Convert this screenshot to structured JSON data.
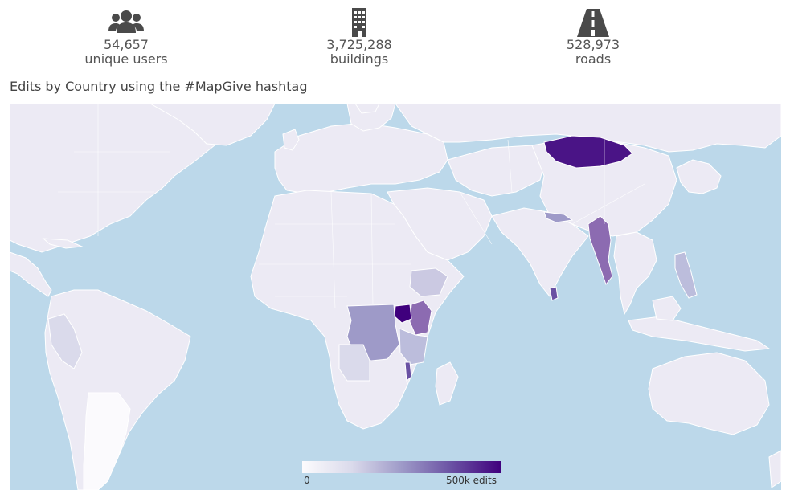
{
  "stats": {
    "users": {
      "value": "54,657",
      "label": "unique users",
      "icon": "users-icon"
    },
    "buildings": {
      "value": "3,725,288",
      "label": "buildings",
      "icon": "building-icon"
    },
    "roads": {
      "value": "528,973",
      "label": "roads",
      "icon": "road-icon"
    }
  },
  "map": {
    "title": "Edits by Country using the #MapGive hashtag",
    "ocean_color": "#bcd8ea",
    "land_color": "#eceaf4",
    "border_color": "#ffffff",
    "legend": {
      "min_label": "0",
      "max_label": "500k edits",
      "colors": [
        "#fcfbfd",
        "#dadaeb",
        "#9e9ac8",
        "#6a51a3",
        "#3f007d"
      ]
    },
    "highlighted_countries": [
      {
        "name": "Uganda",
        "level": 1.0
      },
      {
        "name": "Mongolia",
        "level": 0.95
      },
      {
        "name": "Myanmar",
        "level": 0.7
      },
      {
        "name": "Sri Lanka",
        "level": 0.7
      },
      {
        "name": "Malawi",
        "level": 0.65
      },
      {
        "name": "Kenya",
        "level": 0.6
      },
      {
        "name": "Democratic Republic of the Congo",
        "level": 0.5
      },
      {
        "name": "Tanzania",
        "level": 0.4
      },
      {
        "name": "Philippines",
        "level": 0.45
      },
      {
        "name": "Nepal",
        "level": 0.45
      },
      {
        "name": "Ethiopia",
        "level": 0.3
      },
      {
        "name": "Angola",
        "level": 0.25
      }
    ]
  }
}
